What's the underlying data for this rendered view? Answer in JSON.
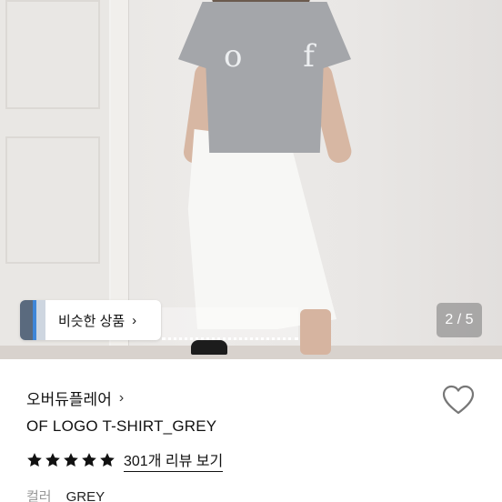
{
  "photo": {
    "shirt_print": "o f",
    "similar_products": {
      "label": "비슷한 상품",
      "chevron": "›"
    },
    "image_counter": "2 / 5"
  },
  "product": {
    "brand": "오버듀플레어",
    "brand_chevron": "›",
    "title": "OF LOGO T-SHIRT_GREY",
    "rating": {
      "stars": 5,
      "review_link": "301개 리뷰 보기"
    },
    "option": {
      "label": "컬러",
      "value": "GREY"
    }
  },
  "icons": {
    "wishlist": "heart-outline-icon",
    "star": "star-icon",
    "similar_thumb": "thumbnail-image"
  },
  "colors": {
    "text": "#111111",
    "muted": "#999999",
    "star": "#111111",
    "heart_stroke": "#777777"
  }
}
